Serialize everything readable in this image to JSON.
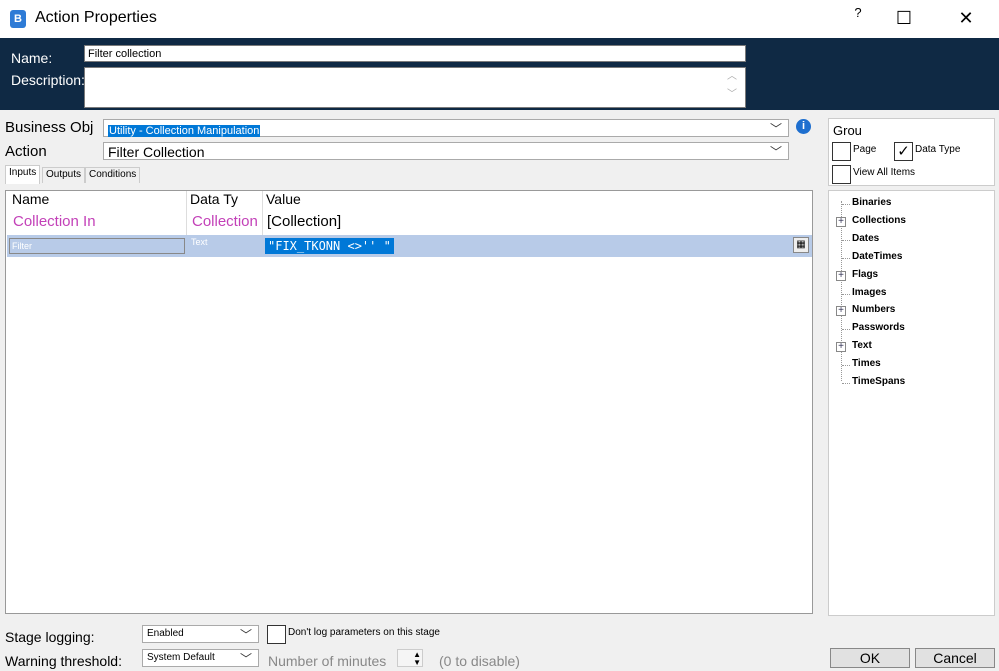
{
  "window": {
    "title": "Action Properties",
    "help": "?",
    "maximize": "☐",
    "close": "✕"
  },
  "header": {
    "name_label": "Name:",
    "name_value": "Filter collection",
    "description_label": "Description:",
    "description_value": ""
  },
  "business_object": {
    "label": "Business Obj",
    "value": "Utility - Collection Manipulation"
  },
  "action": {
    "label": "Action",
    "value": "Filter Collection"
  },
  "tabs": [
    "Inputs",
    "Outputs",
    "Conditions"
  ],
  "grid": {
    "columns": [
      "Name",
      "Data Ty",
      "Value"
    ],
    "rows": [
      {
        "name": "Collection In",
        "type": "Collection",
        "value": "[Collection]"
      },
      {
        "name": "Filter",
        "type": "Text",
        "value": "\"FIX_TKONN <>'' \""
      }
    ]
  },
  "right_panel": {
    "group_label": "Grou",
    "page_label": "Page",
    "page_checked": false,
    "datatype_label": "Data Type",
    "datatype_checked": true,
    "view_all_label": "View All Items",
    "view_all_checked": false,
    "tree": [
      {
        "label": "Binaries",
        "expandable": false
      },
      {
        "label": "Collections",
        "expandable": true
      },
      {
        "label": "Dates",
        "expandable": false
      },
      {
        "label": "DateTimes",
        "expandable": false
      },
      {
        "label": "Flags",
        "expandable": true
      },
      {
        "label": "Images",
        "expandable": false
      },
      {
        "label": "Numbers",
        "expandable": true
      },
      {
        "label": "Passwords",
        "expandable": false
      },
      {
        "label": "Text",
        "expandable": true
      },
      {
        "label": "Times",
        "expandable": false
      },
      {
        "label": "TimeSpans",
        "expandable": false
      }
    ]
  },
  "footer": {
    "stage_logging_label": "Stage logging:",
    "stage_logging_value": "Enabled",
    "dont_log_label": "Don't log parameters on this stage",
    "warning_label": "Warning threshold:",
    "warning_value": "System Default",
    "minutes_label": "Number of minutes",
    "disable_hint": "(0 to disable)",
    "ok": "OK",
    "cancel": "Cancel"
  }
}
